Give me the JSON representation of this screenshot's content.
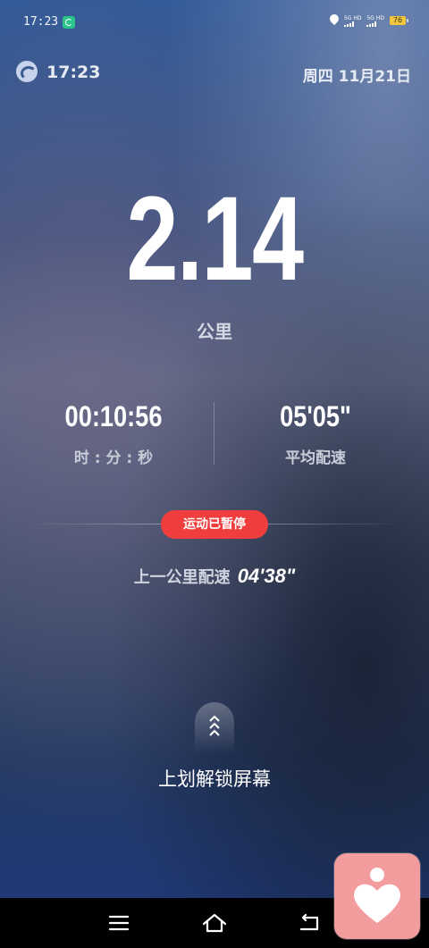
{
  "status_bar": {
    "time": "17:23",
    "sim1_label": "5G HD",
    "sim2_label": "5G HD",
    "battery": "76"
  },
  "header": {
    "time": "17:23",
    "date": "周四 11月21日"
  },
  "workout": {
    "distance": "2.14",
    "distance_unit": "公里",
    "duration": "00:10:56",
    "duration_label": "时 : 分 : 秒",
    "avg_pace": "05'05\"",
    "avg_pace_label": "平均配速",
    "status_badge": "运动已暂停",
    "last_km_pace_label": "上一公里配速",
    "last_km_pace": "04'38\""
  },
  "unlock": {
    "text": "上划解锁屏幕"
  },
  "colors": {
    "badge": "#f03e3e",
    "widget": "#f29c9e",
    "nav_bg": "#000000"
  },
  "icons": {
    "status_app": "app-notification-icon",
    "location": "location-icon",
    "header_app": "sports-app-icon",
    "unlock": "chevron-up-icon",
    "nav_menu": "menu-icon",
    "nav_home": "home-icon",
    "nav_back": "back-icon",
    "widget": "heart-person-icon"
  }
}
